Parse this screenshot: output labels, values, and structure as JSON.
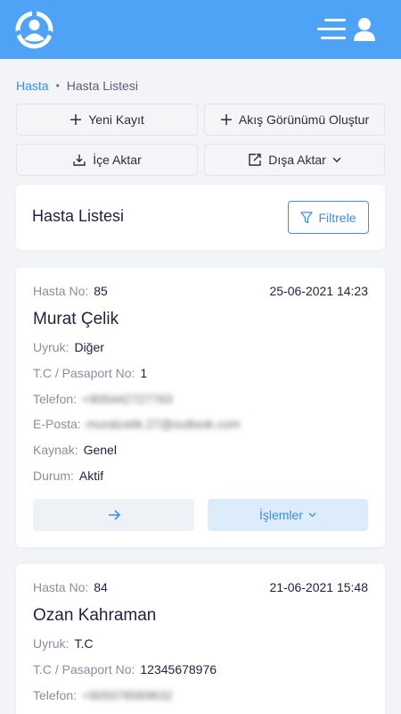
{
  "app": {
    "accent": "#4fa3f7",
    "link": "#3b8ff0"
  },
  "breadcrumb": {
    "home": "Hasta",
    "current": "Hasta Listesi"
  },
  "actions": {
    "new_record": "Yeni Kayıt",
    "create_flow": "Akış Görünümü Oluştur",
    "import": "İçe Aktar",
    "export": "Dışa Aktar"
  },
  "list": {
    "title": "Hasta Listesi",
    "filter_label": "Filtrele"
  },
  "labels": {
    "patient_no": "Hasta No:",
    "nationality": "Uyruk:",
    "id_passport": "T.C / Pasaport No:",
    "phone": "Telefon:",
    "email": "E-Posta:",
    "source": "Kaynak:",
    "status": "Durum:",
    "operations": "İşlemler"
  },
  "patients": [
    {
      "no": "85",
      "date": "25-06-2021 14:23",
      "name": "Murat Çelik",
      "nationality": "Diğer",
      "id_passport": "1",
      "phone": "+905442727763",
      "email": "muratcelik.27@outlook.com",
      "source": "Genel",
      "status": "Aktif"
    },
    {
      "no": "84",
      "date": "21-06-2021 15:48",
      "name": "Ozan Kahraman",
      "nationality": "T.C",
      "id_passport": "12345678976",
      "phone": "+905078569632"
    }
  ],
  "icons": [
    "logo-icon",
    "menu-icon",
    "user-icon",
    "plus-icon",
    "import-icon",
    "export-icon",
    "chevron-down-icon",
    "filter-icon",
    "arrow-right-icon"
  ]
}
